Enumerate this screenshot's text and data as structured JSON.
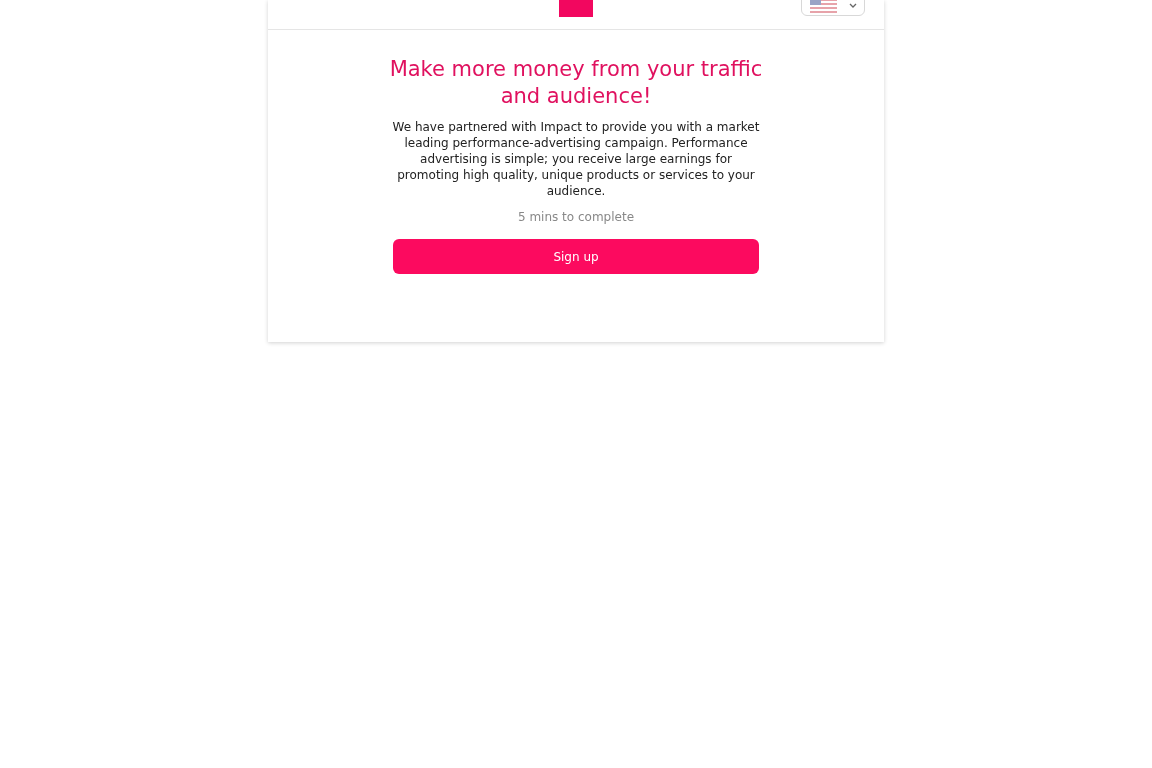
{
  "heading": "Make more money from your traffic and audience!",
  "description": "We have partnered with Impact to provide you with a market leading performance-advertising campaign. Performance advertising is simple; you receive large earnings for promoting high quality, unique products or services to your audience.",
  "duration": "5 mins to complete",
  "button": "Sign up"
}
